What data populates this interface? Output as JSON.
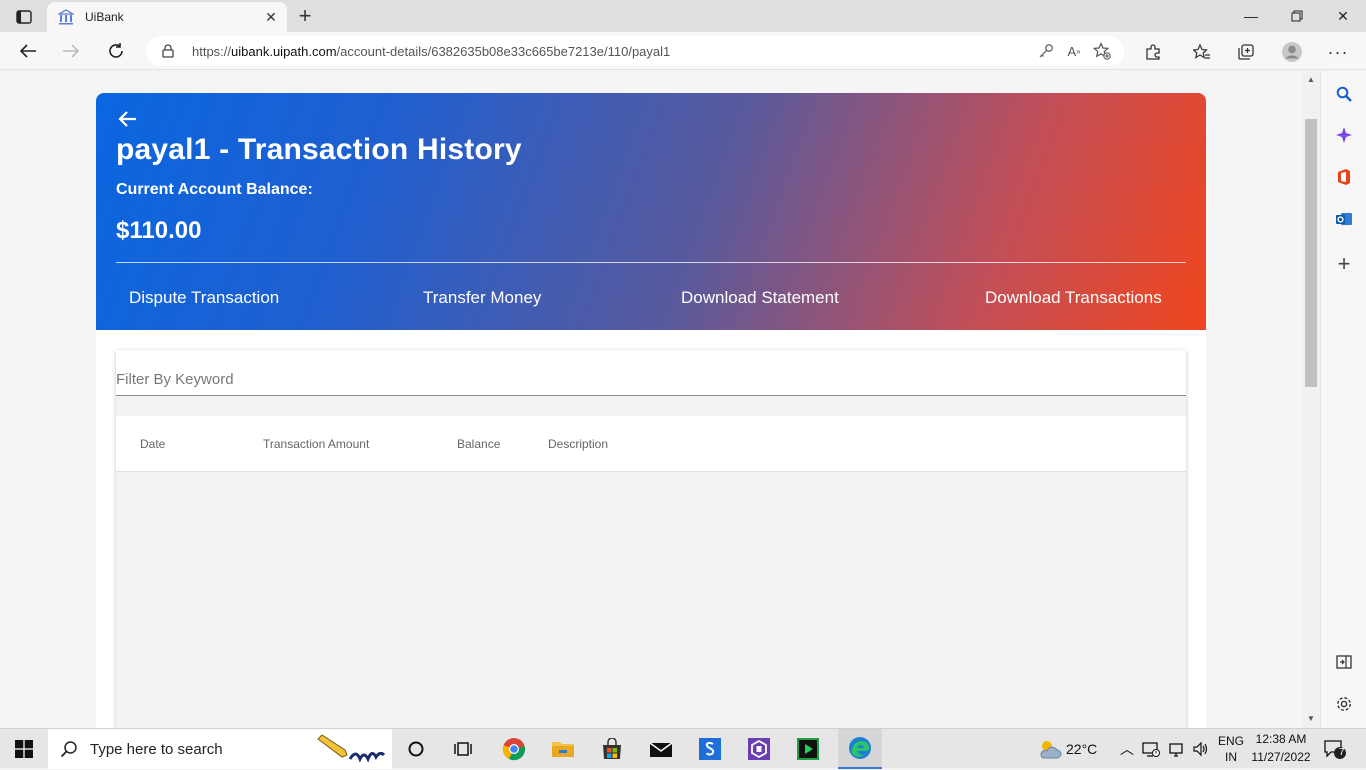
{
  "browser": {
    "tab_title": "UiBank",
    "url_prefix": "https://",
    "url_host": "uibank.uipath.com",
    "url_path": "/account-details/6382635b08e33c665be7213e/110/payal1"
  },
  "header": {
    "title": "payal1 - Transaction History",
    "balance_label": "Current Account Balance:",
    "balance_value": "$110.00",
    "actions": [
      {
        "label": "Dispute Transaction"
      },
      {
        "label": "Transfer Money"
      },
      {
        "label": "Download Statement"
      },
      {
        "label": "Download Transactions"
      }
    ]
  },
  "filter": {
    "placeholder": "Filter By Keyword"
  },
  "table": {
    "columns": [
      "Date",
      "Transaction Amount",
      "Balance",
      "Description"
    ]
  },
  "taskbar": {
    "search_placeholder": "Type here to search",
    "weather": "22°C",
    "lang_top": "ENG",
    "lang_bottom": "IN",
    "time": "12:38 AM",
    "date": "11/27/2022",
    "notifications": "7"
  },
  "colors": {
    "gradient_start": "#0a66e0",
    "gradient_end": "#f0461e"
  }
}
